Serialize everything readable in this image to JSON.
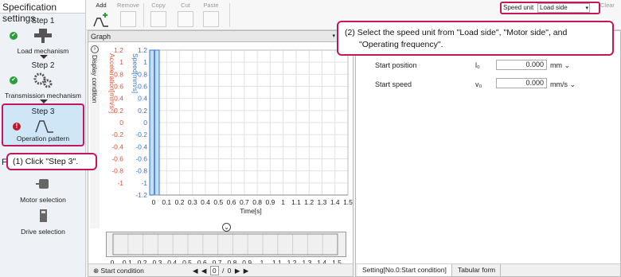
{
  "left": {
    "title": "Specification settings",
    "steps": [
      {
        "name": "Step 1",
        "label": "Load mechanism"
      },
      {
        "name": "Step 2",
        "label": "Transmission mechanism"
      },
      {
        "name": "Step 3",
        "label": "Operation pattern"
      }
    ],
    "func_header": "F",
    "functions": [
      "Motor selection",
      "Drive selection"
    ]
  },
  "toolbar": {
    "add": "Add",
    "remove": "Remove",
    "copy": "Copy",
    "cut": "Cut",
    "paste": "Paste",
    "speed_unit_label": "Speed unit",
    "speed_unit_value": "Load side",
    "clear": "Clear"
  },
  "graph": {
    "title": "Graph",
    "display_condition": "Display condition",
    "start_condition": "Start condition",
    "page_current": "0",
    "page_sep": "/",
    "page_total": "0"
  },
  "chart_data": {
    "type": "line",
    "xlabel": "Time[s]",
    "ylabel_left": "Acceleration[mm/s²]",
    "ylabel_right": "Speed[mm/s]",
    "xlim": [
      0,
      1.5
    ],
    "ylim": [
      -1.2,
      1.2
    ],
    "x_ticks": [
      "0",
      "0.1",
      "0.2",
      "0.3",
      "0.4",
      "0.5",
      "0.6",
      "0.7",
      "0.8",
      "0.9",
      "1",
      "1.1",
      "1.2",
      "1.3",
      "1.4",
      "1.5"
    ],
    "y_ticks_accel": [
      "1.2",
      "1",
      "0.8",
      "0.6",
      "0.4",
      "0.2",
      "0",
      "-0.2",
      "-0.4",
      "-0.6",
      "-0.8",
      "-1"
    ],
    "y_ticks_speed": [
      "1.2",
      "1",
      "0.8",
      "0.6",
      "0.4",
      "0.2",
      "0",
      "-0.2",
      "-0.4",
      "-0.6",
      "-0.8",
      "-1",
      "-1.2"
    ],
    "series": [],
    "grid": true,
    "colors": {
      "accel": "#e05030",
      "speed": "#3a6fd8",
      "highlight": "#bfe0f7"
    }
  },
  "overview_ticks": [
    "0",
    "0.1",
    "0.2",
    "0.3",
    "0.4",
    "0.5",
    "0.6",
    "0.7",
    "0.8",
    "0.9",
    "1",
    "1.1",
    "1.2",
    "1.3",
    "1.4",
    "1.5"
  ],
  "settings": {
    "start_position_label": "Start position",
    "start_position_sym": "l₀",
    "start_position_value": "0.000",
    "start_position_unit": "mm",
    "start_speed_label": "Start speed",
    "start_speed_sym": "v₀",
    "start_speed_value": "0.000",
    "start_speed_unit": "mm/s",
    "tab_setting": "Setting[No.0:Start condition]",
    "tab_tabular": "Tabular form"
  },
  "callouts": {
    "c1": "(1) Click \"Step 3\".",
    "c2_line1": "(2) Select the speed unit from \"Load side\", \"Motor side\", and",
    "c2_line2": "\"Operating frequency\"."
  },
  "colors": {
    "accent": "#c2185b",
    "selected_step": "#cfe6f7"
  }
}
